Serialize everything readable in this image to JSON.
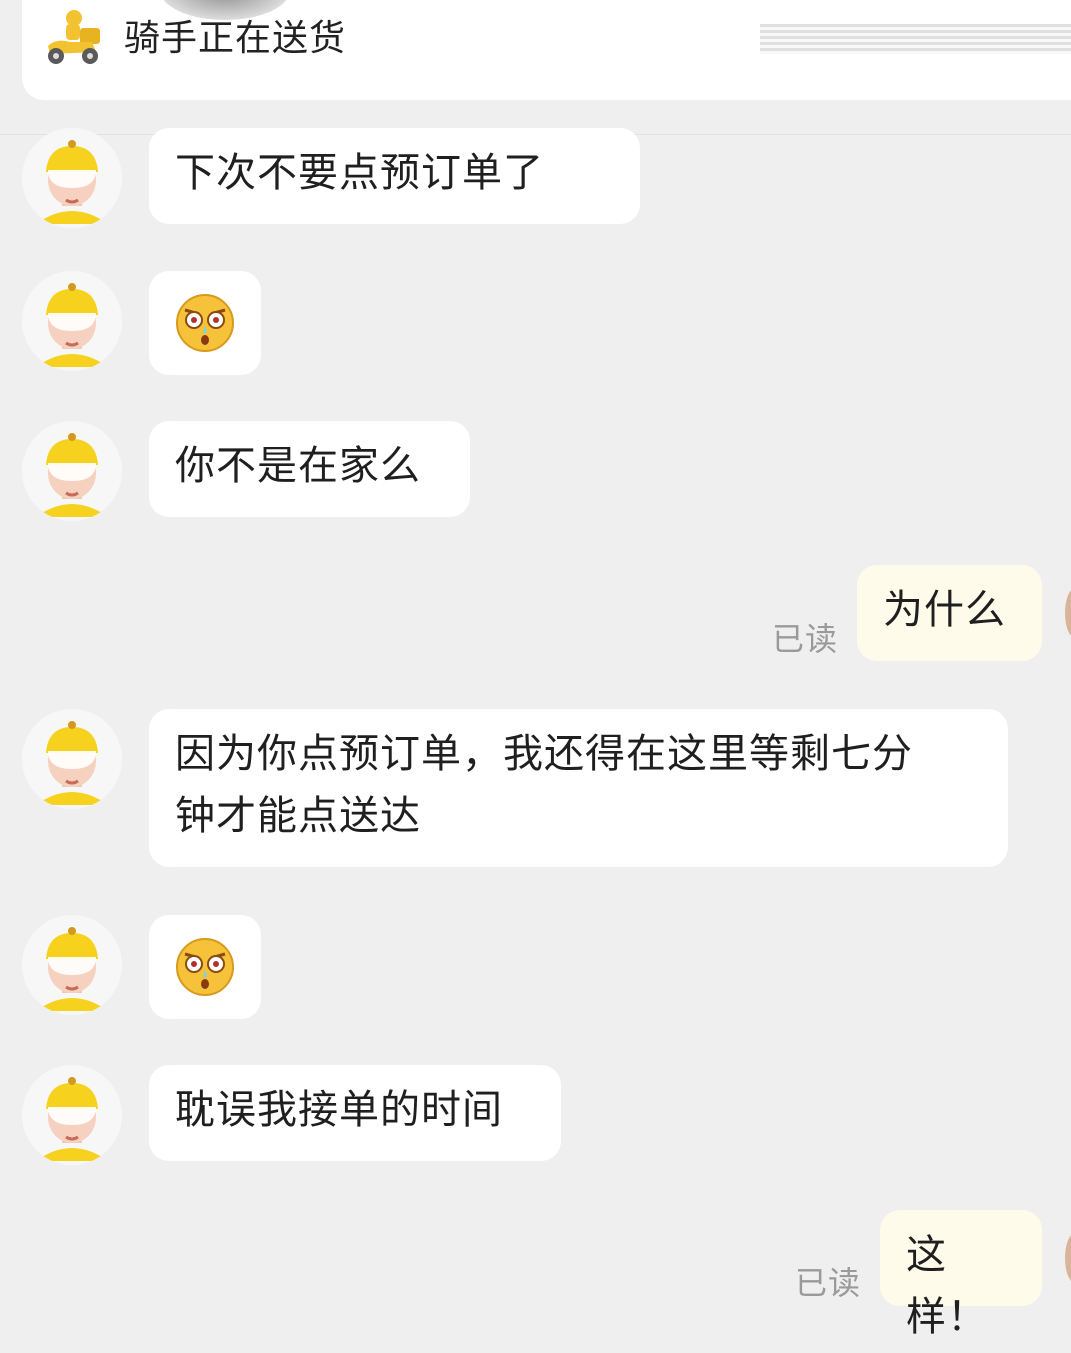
{
  "status": {
    "text": "骑手正在送货"
  },
  "messages": {
    "m1": "下次不要点预订单了",
    "m3": "你不是在家么",
    "m4": "为什么",
    "m5_line1": "因为你点预订单，我还得在这里等剩七分",
    "m5_line2": "钟才能点送达",
    "m7": "耽误我接单的时间",
    "m8": "这样！"
  },
  "receipt": {
    "read_label": "已读"
  },
  "icons": {
    "rider_status": "delivery-scooter-icon",
    "emoji": "shocked-face-emoji"
  }
}
